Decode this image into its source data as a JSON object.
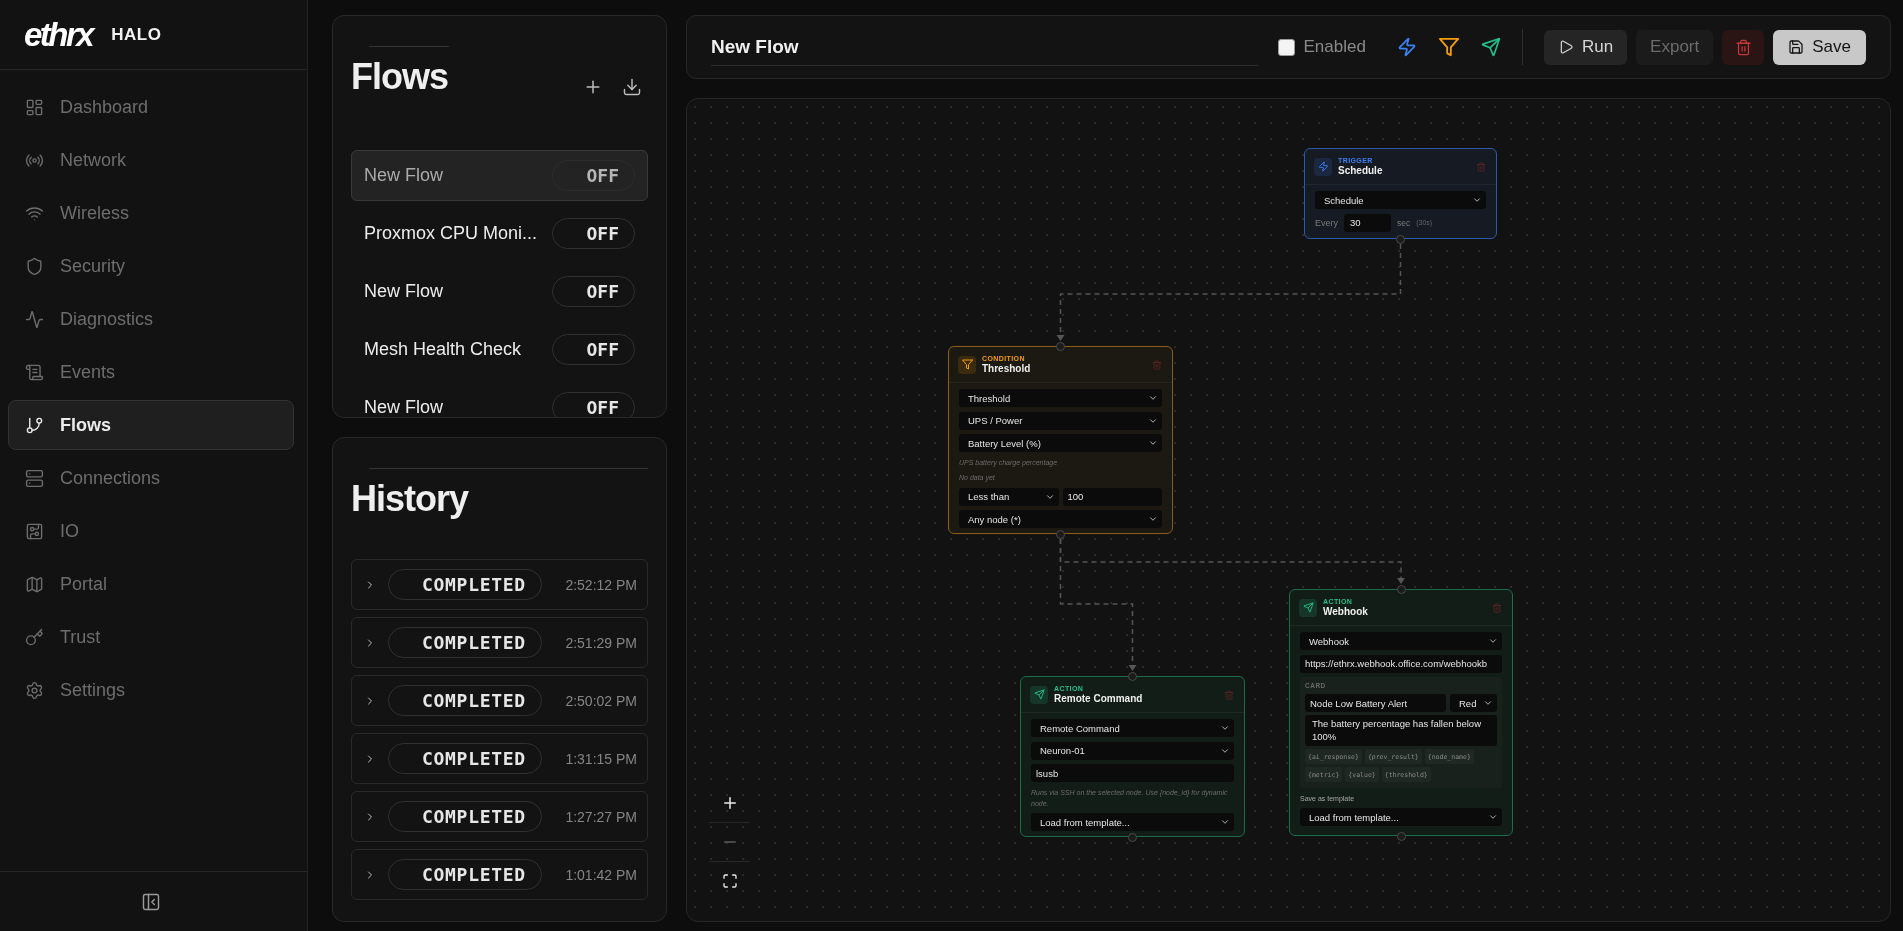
{
  "brand": {
    "logo": "ethrx",
    "name": "HALO"
  },
  "sidebar": {
    "items": [
      {
        "label": "Dashboard",
        "selected": false
      },
      {
        "label": "Network",
        "selected": false
      },
      {
        "label": "Wireless",
        "selected": false
      },
      {
        "label": "Security",
        "selected": false
      },
      {
        "label": "Diagnostics",
        "selected": false
      },
      {
        "label": "Events",
        "selected": false
      },
      {
        "label": "Flows",
        "selected": true
      },
      {
        "label": "Connections",
        "selected": false
      },
      {
        "label": "IO",
        "selected": false
      },
      {
        "label": "Portal",
        "selected": false
      },
      {
        "label": "Trust",
        "selected": false
      },
      {
        "label": "Settings",
        "selected": false
      }
    ]
  },
  "flows_panel": {
    "title": "Flows",
    "flows": [
      {
        "name": "New Flow",
        "status": "OFF",
        "selected": true
      },
      {
        "name": "Proxmox CPU Moni...",
        "status": "OFF",
        "selected": false
      },
      {
        "name": "New Flow",
        "status": "OFF",
        "selected": false
      },
      {
        "name": "Mesh Health Check",
        "status": "OFF",
        "selected": false
      },
      {
        "name": "New Flow",
        "status": "OFF",
        "selected": false
      }
    ]
  },
  "history_panel": {
    "title": "History",
    "runs": [
      {
        "status": "COMPLETED",
        "time": "2:52:12 PM",
        "expanded": false
      },
      {
        "status": "COMPLETED",
        "time": "2:51:29 PM",
        "expanded": false
      },
      {
        "status": "COMPLETED",
        "time": "2:50:02 PM",
        "expanded": false
      },
      {
        "status": "COMPLETED",
        "time": "1:31:15 PM",
        "expanded": false
      },
      {
        "status": "COMPLETED",
        "time": "1:27:27 PM",
        "expanded": false
      },
      {
        "status": "COMPLETED",
        "time": "1:01:42 PM",
        "expanded": false
      }
    ]
  },
  "toolbar": {
    "flow_name": "New Flow",
    "enabled": {
      "label": "Enabled",
      "checked": false
    },
    "add_node_buttons": [
      {
        "kind": "trigger"
      },
      {
        "kind": "condition"
      },
      {
        "kind": "action"
      }
    ],
    "buttons": [
      {
        "kind": "run",
        "label": "Run",
        "disabled": false
      },
      {
        "kind": "export",
        "label": "Export",
        "disabled": true
      },
      {
        "kind": "delete",
        "disabled": false
      },
      {
        "kind": "save",
        "label": "Save",
        "disabled": false
      }
    ]
  },
  "canvas": {
    "nodes": [
      {
        "kind": "trigger",
        "type_label": "TRIGGER",
        "title": "Schedule",
        "fields": [
          {
            "kind": "select",
            "value": "Schedule"
          },
          {
            "kind": "interval",
            "label": "Every",
            "value": "30",
            "unit": "sec",
            "summary": "(30s)"
          }
        ]
      },
      {
        "kind": "condition",
        "type_label": "CONDITION",
        "title": "Threshold",
        "fields": [
          {
            "kind": "select",
            "value": "Threshold"
          },
          {
            "kind": "select",
            "value": "UPS / Power"
          },
          {
            "kind": "select",
            "value": "Battery Level (%)"
          },
          {
            "kind": "note",
            "text": "UPS battery charge percentage"
          },
          {
            "kind": "note",
            "text": "No data yet"
          },
          {
            "kind": "row",
            "items": [
              {
                "kind": "select",
                "value": "Less than"
              },
              {
                "kind": "input",
                "value": "100"
              }
            ]
          },
          {
            "kind": "select",
            "value": "Any node (*)"
          }
        ]
      },
      {
        "kind": "action",
        "type_label": "ACTION",
        "title": "Remote Command",
        "fields": [
          {
            "kind": "select",
            "value": "Remote Command"
          },
          {
            "kind": "select",
            "value": "Neuron-01"
          },
          {
            "kind": "input",
            "value": "lsusb"
          },
          {
            "kind": "note",
            "text": "Runs via SSH on the selected node. Use {node_id} for dynamic node."
          },
          {
            "kind": "select",
            "value": "Load from template..."
          }
        ]
      },
      {
        "kind": "action",
        "type_label": "ACTION",
        "title": "Webhook",
        "fields": [
          {
            "kind": "select",
            "value": "Webhook"
          },
          {
            "kind": "input",
            "value": "https://ethrx.webhook.office.com/webhookb"
          },
          {
            "kind": "card",
            "label": "CARD",
            "fields": [
              {
                "kind": "row",
                "items": [
                  {
                    "kind": "input",
                    "value": "Node Low Battery Alert"
                  },
                  {
                    "kind": "select",
                    "value": "Red"
                  }
                ]
              },
              {
                "kind": "textarea",
                "value": "The battery percentage has fallen below 100%"
              },
              {
                "kind": "tags",
                "tags": [
                  "{ai_response}",
                  "{prev_result}",
                  "{node_name}",
                  "{metric}",
                  "{value}",
                  "{threshold}"
                ]
              }
            ]
          },
          {
            "kind": "label",
            "text": "Save as template"
          },
          {
            "kind": "select",
            "value": "Load from template..."
          }
        ]
      }
    ],
    "zoom_controls": [
      {
        "kind": "zoom_in",
        "disabled": false
      },
      {
        "kind": "zoom_out",
        "disabled": true
      },
      {
        "kind": "fit",
        "disabled": false
      }
    ]
  }
}
